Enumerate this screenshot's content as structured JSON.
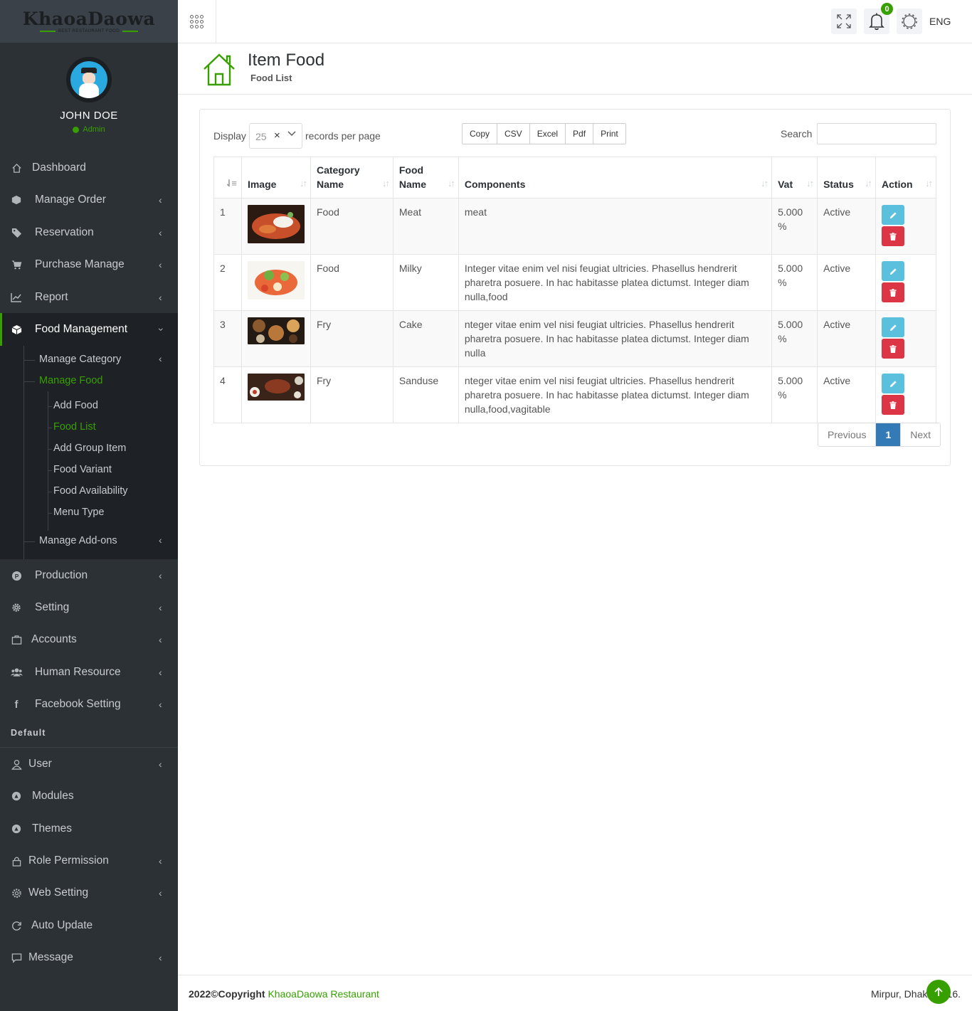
{
  "brand": {
    "name": "KhaoaDaowa",
    "tagline": "BEST RESTAURANT FOOD"
  },
  "user": {
    "name": "JOHN DOE",
    "role": "Admin"
  },
  "sidebar": {
    "items": [
      {
        "label": "Dashboard",
        "icon": "home-icon"
      },
      {
        "label": "Manage Order",
        "icon": "cube-icon"
      },
      {
        "label": "Reservation",
        "icon": "tags-icon"
      },
      {
        "label": "Purchase Manage",
        "icon": "cart-icon"
      },
      {
        "label": "Report",
        "icon": "line-chart-icon"
      },
      {
        "label": "Food Management",
        "icon": "box-icon"
      },
      {
        "label": "Production",
        "icon": "production-icon"
      },
      {
        "label": "Setting",
        "icon": "gear-icon"
      },
      {
        "label": "Accounts",
        "icon": "briefcase-icon"
      },
      {
        "label": "Human Resource",
        "icon": "users-icon"
      },
      {
        "label": "Facebook Setting",
        "icon": "facebook-icon"
      }
    ],
    "food_submenu": {
      "manage_category": "Manage Category",
      "manage_food": "Manage Food",
      "children": [
        "Add Food",
        "Food List",
        "Add Group Item",
        "Food Variant",
        "Food Availability",
        "Menu Type"
      ],
      "manage_addons": "Manage Add-ons"
    },
    "section_default": "Default",
    "default_items": [
      {
        "label": "User",
        "icon": "user-icon"
      },
      {
        "label": "Modules",
        "icon": "modules-icon"
      },
      {
        "label": "Themes",
        "icon": "themes-icon"
      },
      {
        "label": "Role Permission",
        "icon": "lock-icon"
      },
      {
        "label": "Web Setting",
        "icon": "cog-icon"
      },
      {
        "label": "Auto Update",
        "icon": "refresh-icon"
      },
      {
        "label": "Message",
        "icon": "comment-icon"
      }
    ]
  },
  "topbar": {
    "notification_count": "0",
    "language": "ENG"
  },
  "page": {
    "title": "Item Food",
    "subtitle": "Food List"
  },
  "table_controls": {
    "display_label": "Display",
    "per_page_value": "25",
    "records_label": "records per page",
    "export_buttons": [
      "Copy",
      "CSV",
      "Excel",
      "Pdf",
      "Print"
    ],
    "search_label": "Search",
    "search_value": ""
  },
  "table": {
    "headers": [
      "",
      "Image",
      "Category Name",
      "Food Name",
      "Components",
      "Vat",
      "Status",
      "Action"
    ],
    "rows": [
      {
        "num": "1",
        "category": "Food",
        "food": "Meat",
        "components": "meat",
        "vat": "5.000 %",
        "status": "Active"
      },
      {
        "num": "2",
        "category": "Food",
        "food": "Milky",
        "components": "Integer vitae enim vel nisi feugiat ultricies. Phasellus hendrerit pharetra posuere. In hac habitasse platea dictumst. Integer diam nulla,food",
        "vat": "5.000 %",
        "status": "Active"
      },
      {
        "num": "3",
        "category": "Fry",
        "food": "Cake",
        "components": "nteger vitae enim vel nisi feugiat ultricies. Phasellus hendrerit pharetra posuere. In hac habitasse platea dictumst. Integer diam nulla",
        "vat": "5.000 %",
        "status": "Active"
      },
      {
        "num": "4",
        "category": "Fry",
        "food": "Sanduse",
        "components": "nteger vitae enim vel nisi feugiat ultricies. Phasellus hendrerit pharetra posuere. In hac habitasse platea dictumst. Integer diam nulla,food,vagitable",
        "vat": "5.000 %",
        "status": "Active"
      }
    ]
  },
  "pagination": {
    "previous": "Previous",
    "current": "1",
    "next": "Next"
  },
  "footer": {
    "copyright": "2022©Copyright",
    "link": "KhaoaDaowa Restaurant",
    "address": "Mirpur, Dhaka 1216."
  },
  "colors": {
    "accent": "#37a000",
    "sidebar": "#2c3136",
    "edit": "#5bc0de",
    "delete": "#dc3545",
    "page_active": "#337ab7"
  }
}
